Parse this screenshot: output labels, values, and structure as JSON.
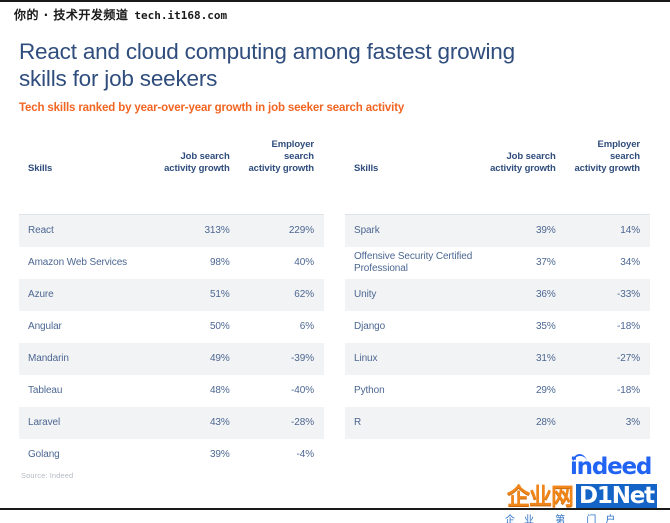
{
  "banner": {
    "prefix": "你的 · 技术开发频道",
    "url": "tech.it168.com"
  },
  "slide": {
    "title": "React and cloud computing among fastest growing skills for job seekers",
    "subtitle": "Tech skills ranked by year-over-year growth in job seeker search activity",
    "source": "Source: Indeed"
  },
  "colors": {
    "title_blue": "#2f4d7d",
    "accent_orange": "#f26522",
    "body_blue": "#4c6792",
    "row_shade": "#f2f3f4",
    "indeed_blue": "#2164f3",
    "d1net_orange": "#f08519",
    "d1net_blue": "#1464c8"
  },
  "table_headers": {
    "skills": "Skills",
    "job_search_line1": "Job search",
    "job_search_line2": "activity growth",
    "employer_search_line1": "Employer search",
    "employer_search_line2": "activity growth"
  },
  "chart_data": {
    "type": "table",
    "title": "React and cloud computing among fastest growing skills for job seekers",
    "subtitle": "Tech skills ranked by year-over-year growth in job seeker search activity",
    "columns": [
      "Skills",
      "Job search activity growth",
      "Employer search activity growth"
    ],
    "source": "Indeed",
    "left_table": [
      {
        "skill": "React",
        "job": "313%",
        "employer": "229%"
      },
      {
        "skill": "Amazon Web Services",
        "job": "98%",
        "employer": "40%"
      },
      {
        "skill": "Azure",
        "job": "51%",
        "employer": "62%"
      },
      {
        "skill": "Angular",
        "job": "50%",
        "employer": "6%"
      },
      {
        "skill": "Mandarin",
        "job": "49%",
        "employer": "-39%"
      },
      {
        "skill": "Tableau",
        "job": "48%",
        "employer": "-40%"
      },
      {
        "skill": "Laravel",
        "job": "43%",
        "employer": "-28%"
      },
      {
        "skill": "Golang",
        "job": "39%",
        "employer": "-4%"
      }
    ],
    "right_table": [
      {
        "skill": "Spark",
        "job": "39%",
        "employer": "14%"
      },
      {
        "skill": "Offensive Security Certified Professional",
        "job": "37%",
        "employer": "34%"
      },
      {
        "skill": "Unity",
        "job": "36%",
        "employer": "-33%"
      },
      {
        "skill": "Django",
        "job": "35%",
        "employer": "-18%"
      },
      {
        "skill": "Linux",
        "job": "31%",
        "employer": "-27%"
      },
      {
        "skill": "Python",
        "job": "29%",
        "employer": "-18%"
      },
      {
        "skill": "R",
        "job": "28%",
        "employer": "3%"
      }
    ]
  },
  "logos": {
    "indeed": "indeed",
    "d1net_cn": "企业网",
    "d1net_en": "D1Net",
    "bottom_strip": "企业 第 门户"
  }
}
